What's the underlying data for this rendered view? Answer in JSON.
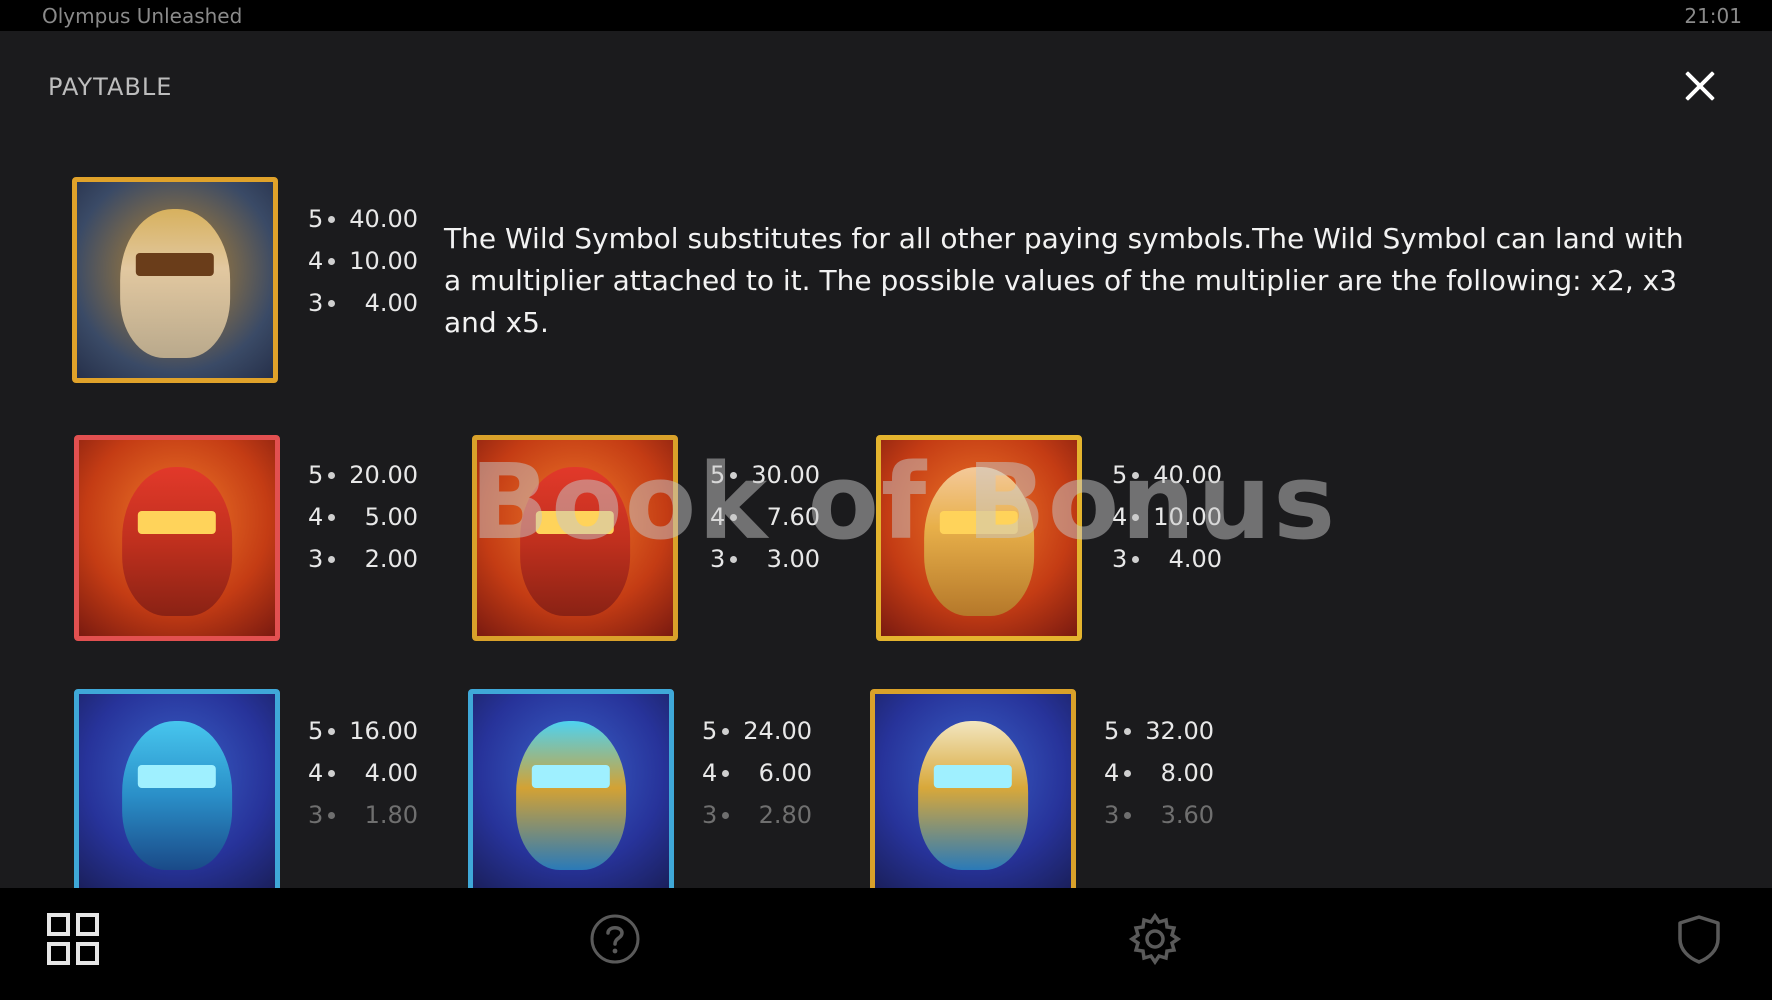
{
  "app": {
    "title": "Olympus Unleashed",
    "clock": "21:01"
  },
  "paytable": {
    "title": "PAYTABLE",
    "wild": {
      "pays": [
        {
          "count": "5",
          "amount": "40.00"
        },
        {
          "count": "4",
          "amount": "10.00"
        },
        {
          "count": "3",
          "amount": "4.00"
        }
      ],
      "description": "The Wild Symbol substitutes for all other paying symbols.The Wild Symbol can land with a multiplier attached to it. The possible values of the multiplier are the following: x2, x3 and x5."
    },
    "red_symbols": [
      {
        "pays": [
          {
            "count": "5",
            "amount": "20.00"
          },
          {
            "count": "4",
            "amount": "5.00"
          },
          {
            "count": "3",
            "amount": "2.00"
          }
        ]
      },
      {
        "pays": [
          {
            "count": "5",
            "amount": "30.00"
          },
          {
            "count": "4",
            "amount": "7.60"
          },
          {
            "count": "3",
            "amount": "3.00"
          }
        ]
      },
      {
        "pays": [
          {
            "count": "5",
            "amount": "40.00"
          },
          {
            "count": "4",
            "amount": "10.00"
          },
          {
            "count": "3",
            "amount": "4.00"
          }
        ]
      }
    ],
    "blue_symbols": [
      {
        "pays": [
          {
            "count": "5",
            "amount": "16.00"
          },
          {
            "count": "4",
            "amount": "4.00"
          },
          {
            "count": "3",
            "amount": "1.80"
          }
        ]
      },
      {
        "pays": [
          {
            "count": "5",
            "amount": "24.00"
          },
          {
            "count": "4",
            "amount": "6.00"
          },
          {
            "count": "3",
            "amount": "2.80"
          }
        ]
      },
      {
        "pays": [
          {
            "count": "5",
            "amount": "32.00"
          },
          {
            "count": "4",
            "amount": "8.00"
          },
          {
            "count": "3",
            "amount": "3.60"
          }
        ]
      }
    ],
    "watermark": "Book of Bonus"
  },
  "nav": {
    "icons": [
      "grid-icon",
      "help-icon",
      "gear-icon",
      "shield-icon"
    ]
  },
  "colors": {
    "background": "#1b1b1d",
    "bars": "#000000",
    "text": "#e8e8e8",
    "dim_text": "#6f6f6f",
    "gold_frame": "#d9a12a",
    "blue_frame": "#3fa8d8",
    "red_frame": "#e25050"
  }
}
